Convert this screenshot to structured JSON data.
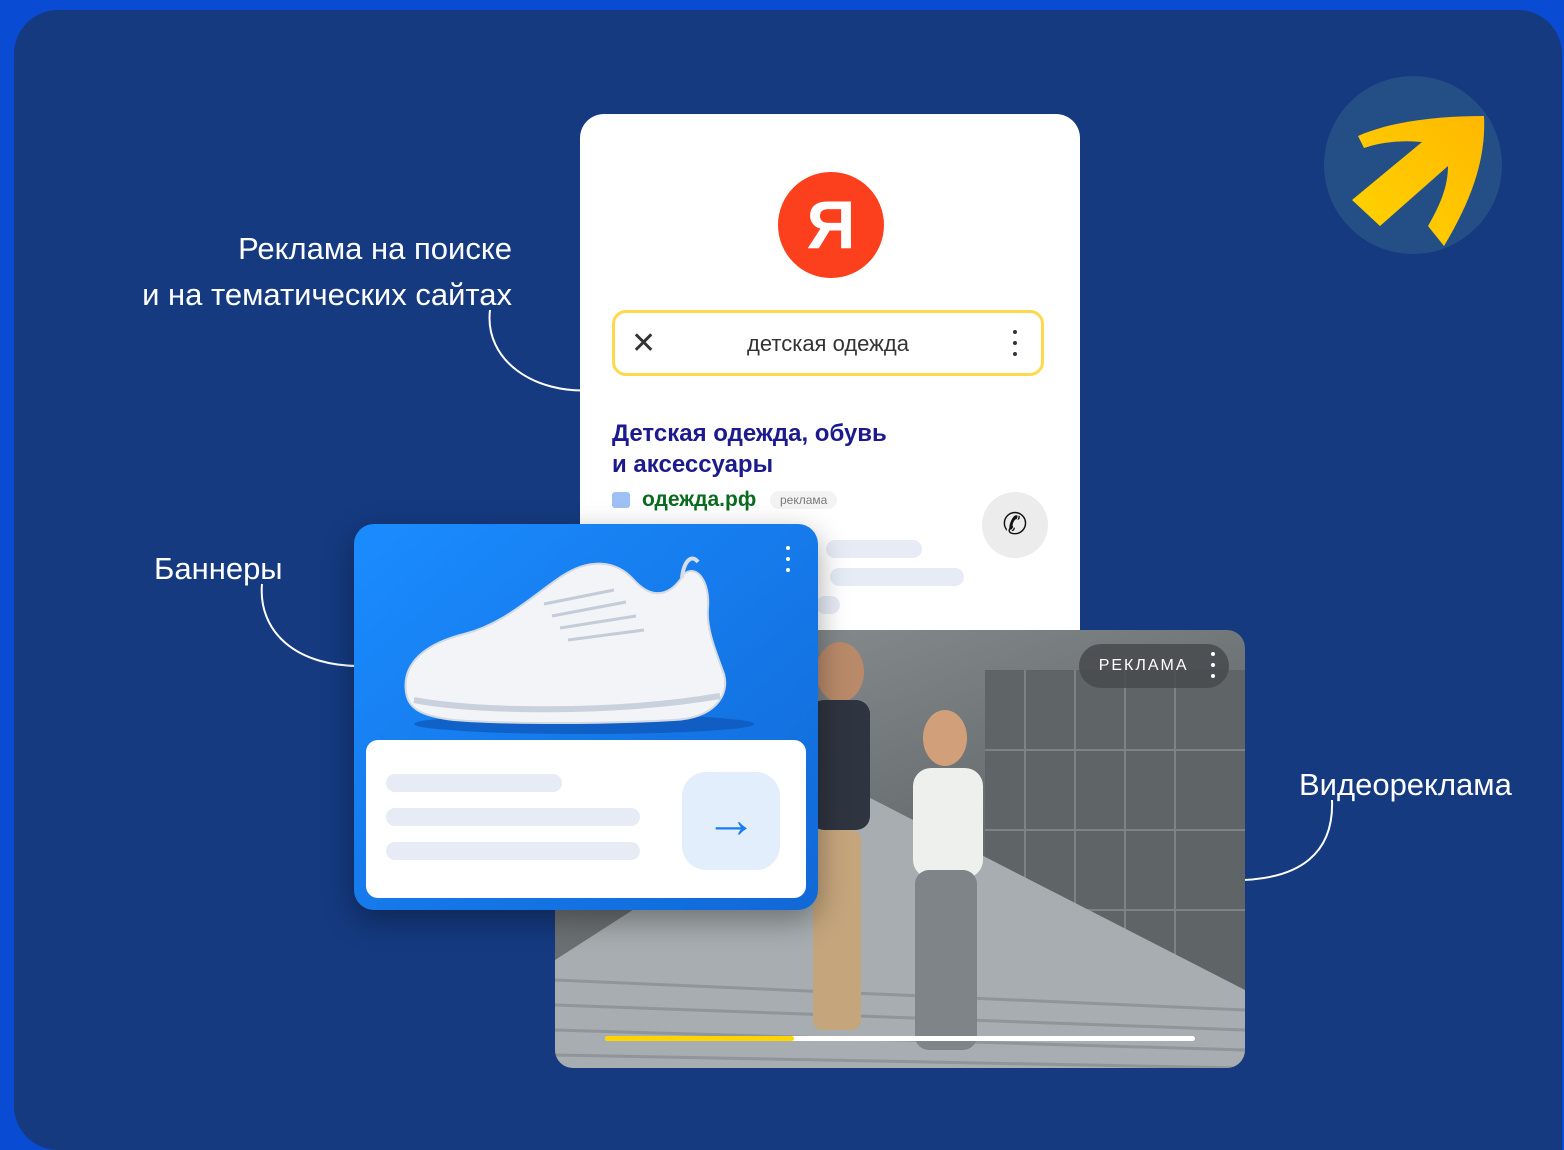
{
  "captions": {
    "search": [
      "Реклама на поиске",
      "и на тематических сайтах"
    ],
    "banners": "Баннеры",
    "video": "Видеореклама"
  },
  "search_card": {
    "logo_letter": "Я",
    "query": "детская одежда",
    "clear_icon": "close-icon",
    "menu_icon": "vertical-dots-icon",
    "result": {
      "title_lines": [
        "Детская одежда, обувь",
        "и аксессуары"
      ],
      "url": "одежда.рф",
      "badge": "реклама",
      "call_icon": "phone-icon"
    }
  },
  "banner_card": {
    "image": "sneaker",
    "menu_icon": "vertical-dots-icon",
    "arrow_icon": "arrow-right-icon"
  },
  "video_card": {
    "badge": "РЕКЛАМА",
    "menu_icon": "vertical-dots-icon",
    "progress_fraction": 0.32
  },
  "brand_mark": "arrow-logo",
  "colors": {
    "page_background": "#153a80",
    "frame": "#0a4bd4",
    "yandex_red": "#fc3f1d",
    "search_border": "#ffd84d",
    "result_title": "#1c1a8c",
    "result_url": "#0b6b20",
    "banner_blue": "#1a8cff",
    "progress_yellow": "#ffd400"
  }
}
